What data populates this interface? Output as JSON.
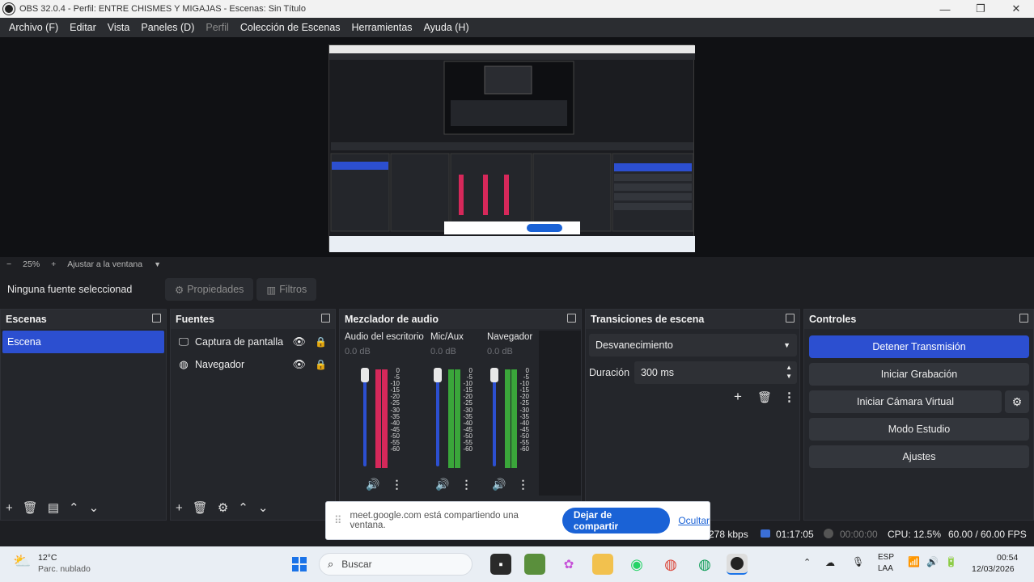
{
  "window": {
    "title": "OBS 32.0.4 - Perfil: ENTRE CHISMES Y MIGAJAS - Escenas: Sin Título",
    "minimize": "—",
    "maximize": "❐",
    "close": "✕"
  },
  "menu": [
    {
      "label": "Archivo (F)",
      "enabled": true
    },
    {
      "label": "Editar",
      "enabled": true
    },
    {
      "label": "Vista",
      "enabled": true
    },
    {
      "label": "Paneles (D)",
      "enabled": true
    },
    {
      "label": "Perfil",
      "enabled": false
    },
    {
      "label": "Colección de Escenas",
      "enabled": true
    },
    {
      "label": "Herramientas",
      "enabled": true
    },
    {
      "label": "Ayuda (H)",
      "enabled": true
    }
  ],
  "preview": {
    "zoom_minus": "−",
    "zoom": "25%",
    "zoom_plus": "+",
    "fit_label": "Ajustar a la ventana"
  },
  "context": {
    "no_source": "Ninguna fuente seleccionad",
    "properties": "Propiedades",
    "filters": "Filtros"
  },
  "scenes": {
    "header": "Escenas",
    "items": [
      "Escena"
    ]
  },
  "sources": {
    "header": "Fuentes",
    "items": [
      {
        "label": "Captura de pantalla",
        "icon": "monitor-icon"
      },
      {
        "label": "Navegador",
        "icon": "globe-icon"
      }
    ]
  },
  "mixer": {
    "header": "Mezclador de audio",
    "scale": [
      "0",
      "-5",
      "-10",
      "-15",
      "-20",
      "-25",
      "-30",
      "-35",
      "-40",
      "-45",
      "-50",
      "-55",
      "-60"
    ],
    "channels": [
      {
        "name": "Audio del escritorio",
        "db": "0.0 dB",
        "level": 0.85,
        "color": "#d6285a"
      },
      {
        "name": "Mic/Aux",
        "db": "0.0 dB",
        "level": 0.85,
        "color": "#3aa63a"
      },
      {
        "name": "Navegador",
        "db": "0.0 dB",
        "level": 0.85,
        "color": "#3aa63a"
      }
    ]
  },
  "transitions": {
    "header": "Transiciones de escena",
    "type": "Desvanecimiento",
    "duration_label": "Duración",
    "duration": "300 ms"
  },
  "controls": {
    "header": "Controles",
    "stop_stream": "Detener Transmisión",
    "start_recording": "Iniciar Grabación",
    "start_virtualcam": "Iniciar Cámara Virtual",
    "studio_mode": "Modo Estudio",
    "settings": "Ajustes"
  },
  "share_banner": {
    "message": "meet.google.com está compartiendo una ventana.",
    "stop": "Dejar de compartir",
    "hide": "Ocultar"
  },
  "status": {
    "bitrate": "278 kbps",
    "stream_time": "01:17:05",
    "rec_time": "00:00:00",
    "cpu": "CPU: 12.5%",
    "fps": "60.00 / 60.00 FPS"
  },
  "taskbar": {
    "weather_temp": "12°C",
    "weather_desc": "Parc. nublado",
    "search": "Buscar",
    "lang1": "ESP",
    "lang2": "LAA",
    "time": "00:54",
    "date": "12/03/2026"
  },
  "colors": {
    "accent": "#2c4fd0",
    "share_button": "#1a62d6"
  }
}
